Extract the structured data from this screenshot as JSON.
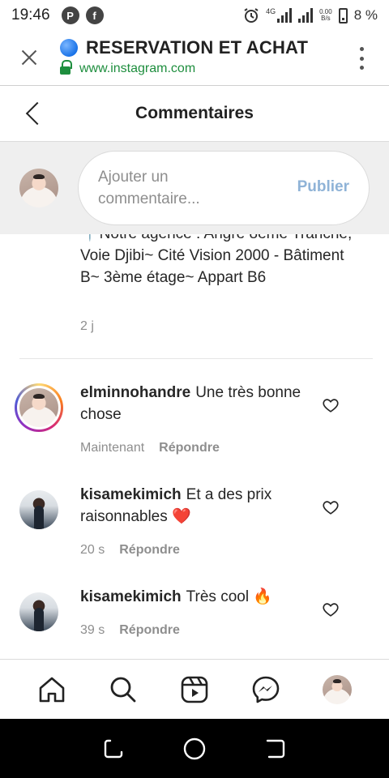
{
  "status_bar": {
    "time": "19:46",
    "network": "4G",
    "speed_value": "0.00",
    "speed_unit": "B/s",
    "battery": "8 %"
  },
  "browser": {
    "page_title": "RESERVATION ET ACHAT",
    "url": "www.instagram.com"
  },
  "header": {
    "title": "Commentaires"
  },
  "composer": {
    "placeholder": "Ajouter un commentaire...",
    "publish_label": "Publier"
  },
  "caption": {
    "text": "📍Notre agence : Angré 8ème Tranche, Voie Djibi~ Cité Vision 2000 - Bâtiment B~ 3ème étage~ Appart B6",
    "time": "2 j"
  },
  "comments": [
    {
      "username": "elminnohandre",
      "text": "Une très bonne chose",
      "time": "Maintenant",
      "reply_label": "Répondre",
      "has_story": true
    },
    {
      "username": "kisamekimich",
      "text": "Et a des prix raisonnables ❤️",
      "time": "20 s",
      "reply_label": "Répondre",
      "has_story": false
    },
    {
      "username": "kisamekimich",
      "text": "Très cool 🔥",
      "time": "39 s",
      "reply_label": "Répondre",
      "has_story": false
    }
  ],
  "bottom_nav": {
    "items": [
      "home-icon",
      "search-icon",
      "reels-icon",
      "messenger-icon",
      "profile-avatar"
    ]
  },
  "colors": {
    "ig_link": "#8fb3d7",
    "secure_green": "#1e8e3e",
    "text_primary": "#262626",
    "text_secondary": "#8e8e8e"
  }
}
